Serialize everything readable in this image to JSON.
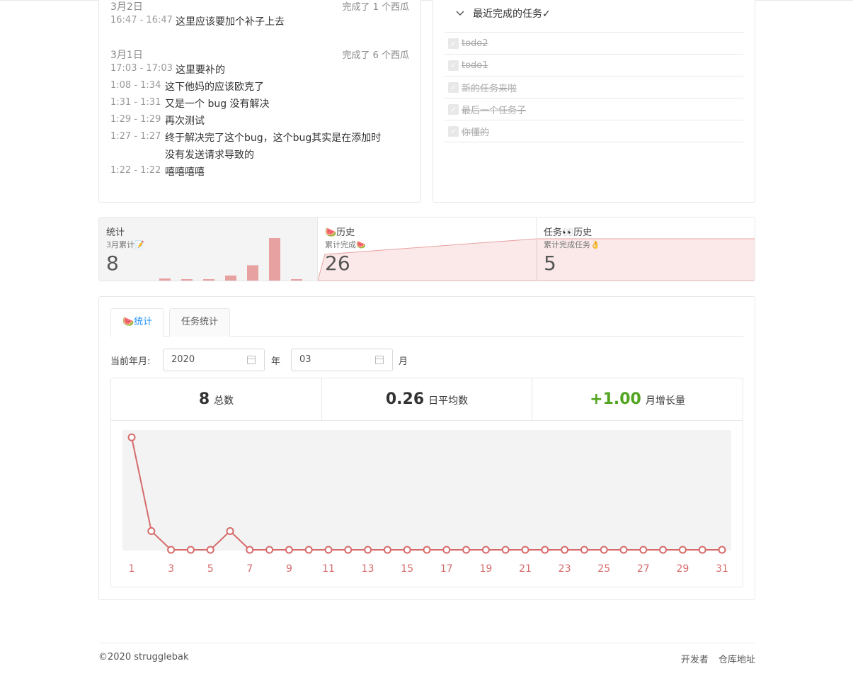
{
  "history": {
    "days": [
      {
        "date": "3月2日",
        "count": "完成了 1 个西瓜",
        "records": [
          {
            "time": "16:47 - 16:47",
            "text": "这里应该要加个补子上去"
          }
        ]
      },
      {
        "date": "3月1日",
        "count": "完成了 6 个西瓜",
        "records": [
          {
            "time": "17:03 - 17:03",
            "text": "这里要补的"
          },
          {
            "time": "1:08 - 1:34",
            "text": "这下他妈的应该欧克了"
          },
          {
            "time": "1:31 - 1:31",
            "text": "又是一个 bug 没有解决"
          },
          {
            "time": "1:29 - 1:29",
            "text": "再次测试"
          },
          {
            "time": "1:27 - 1:27",
            "text": "终于解决完了这个bug，这个bug其实是在添加时"
          },
          {
            "time": "",
            "text": "没有发送请求导致的"
          },
          {
            "time": "1:22 - 1:22",
            "text": "嘻嘻嘻嘻"
          }
        ]
      }
    ]
  },
  "done_tasks": {
    "header": "最近完成的任务✓",
    "items": [
      "todo2",
      "todo1",
      "新的任务来啦",
      "最后一个任务子",
      "你懂的"
    ]
  },
  "stats": [
    {
      "title": "统计",
      "sub": "3月累计📝",
      "value": "8"
    },
    {
      "title": "🍉历史",
      "sub": "累计完成🍉",
      "value": "26"
    },
    {
      "title": "任务👀历史",
      "sub": "累计完成任务👌",
      "value": "5"
    }
  ],
  "mini_bars": [
    0,
    0.05,
    0.03,
    0.03,
    0.12,
    0.36,
    1.0,
    0.03
  ],
  "tabs": [
    "🍉统计",
    "任务统计"
  ],
  "date_filter": {
    "label": "当前年月:",
    "year": "2020",
    "year_unit": "年",
    "month": "03",
    "month_unit": "月"
  },
  "metrics": [
    {
      "value": "8",
      "label": "总数"
    },
    {
      "value": "0.26",
      "label": "日平均数"
    },
    {
      "value": "+1.00",
      "label": "月增长量"
    }
  ],
  "colors": {
    "accent": "#1890ff",
    "line": "#d66b6b",
    "growth": "#52a520",
    "bar": "#e8a1a1"
  },
  "chart_data": {
    "type": "line",
    "x": [
      1,
      2,
      3,
      4,
      5,
      6,
      7,
      8,
      9,
      10,
      11,
      12,
      13,
      14,
      15,
      16,
      17,
      18,
      19,
      20,
      21,
      22,
      23,
      24,
      25,
      26,
      27,
      28,
      29,
      30,
      31
    ],
    "y": [
      6,
      1,
      0,
      0,
      0,
      1,
      0,
      0,
      0,
      0,
      0,
      0,
      0,
      0,
      0,
      0,
      0,
      0,
      0,
      0,
      0,
      0,
      0,
      0,
      0,
      0,
      0,
      0,
      0,
      0,
      0
    ],
    "tick_labels": [
      "1",
      "3",
      "5",
      "7",
      "9",
      "11",
      "13",
      "15",
      "17",
      "19",
      "21",
      "23",
      "25",
      "27",
      "29",
      "31"
    ],
    "ylim": [
      0,
      6.5
    ],
    "grid": false
  },
  "footer": {
    "copyright": "©2020 strugglebak",
    "links": [
      "开发者",
      "仓库地址"
    ]
  }
}
